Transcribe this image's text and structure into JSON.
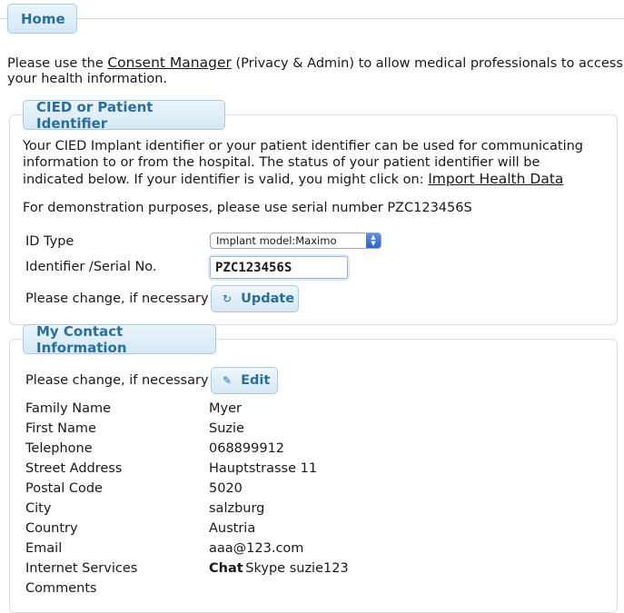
{
  "home_tab": "Home",
  "intro": {
    "pre": "Please use the ",
    "link": "Consent Manager",
    "post_line1": " (Privacy & Admin) to allow medical professionals to access",
    "line2": "your health information."
  },
  "cied": {
    "tab": "CIED or Patient Identifier",
    "desc_line1": "Your CIED Implant identifier or your patient identifier can be used for communicating",
    "desc_line2": "information to or from the hospital. The status of your patient identifier will be",
    "desc_line3": "indicated below. If your identifier is valid, you might click on: ",
    "import_link": "Import Health Data",
    "demo_note": "For demonstration purposes, please use serial number PZC123456S",
    "id_type_label": "ID Type",
    "id_type_value": "Implant model:Maximo",
    "identifier_label": "Identifier /Serial No.",
    "identifier_value": "PZC123456S",
    "change_label": "Please change, if necessary",
    "update_button": "Update"
  },
  "contact": {
    "tab": "My Contact Information",
    "change_label": "Please change, if necessary",
    "edit_button": "Edit",
    "fields": [
      {
        "label": "Family Name",
        "value": "Myer"
      },
      {
        "label": "First Name",
        "value": "Suzie"
      },
      {
        "label": "Telephone",
        "value": "068899912"
      },
      {
        "label": "Street Address",
        "value": "Hauptstrasse 11"
      },
      {
        "label": "Postal Code",
        "value": "5020"
      },
      {
        "label": "City",
        "value": "salzburg"
      },
      {
        "label": "Country",
        "value": "Austria"
      },
      {
        "label": "Email",
        "value": "aaa@123.com"
      }
    ],
    "internet_label": "Internet Services",
    "internet_service_bold": "Chat",
    "internet_service": "Skype suzie123",
    "comments_label": "Comments"
  },
  "colors": {
    "accent": "#2a6e9e",
    "tab_bg": "#d5e8f5",
    "border": "#a9cbe3"
  },
  "icons": {
    "update": "refresh-icon",
    "edit": "pencil-icon",
    "select": "select-arrows-icon"
  }
}
